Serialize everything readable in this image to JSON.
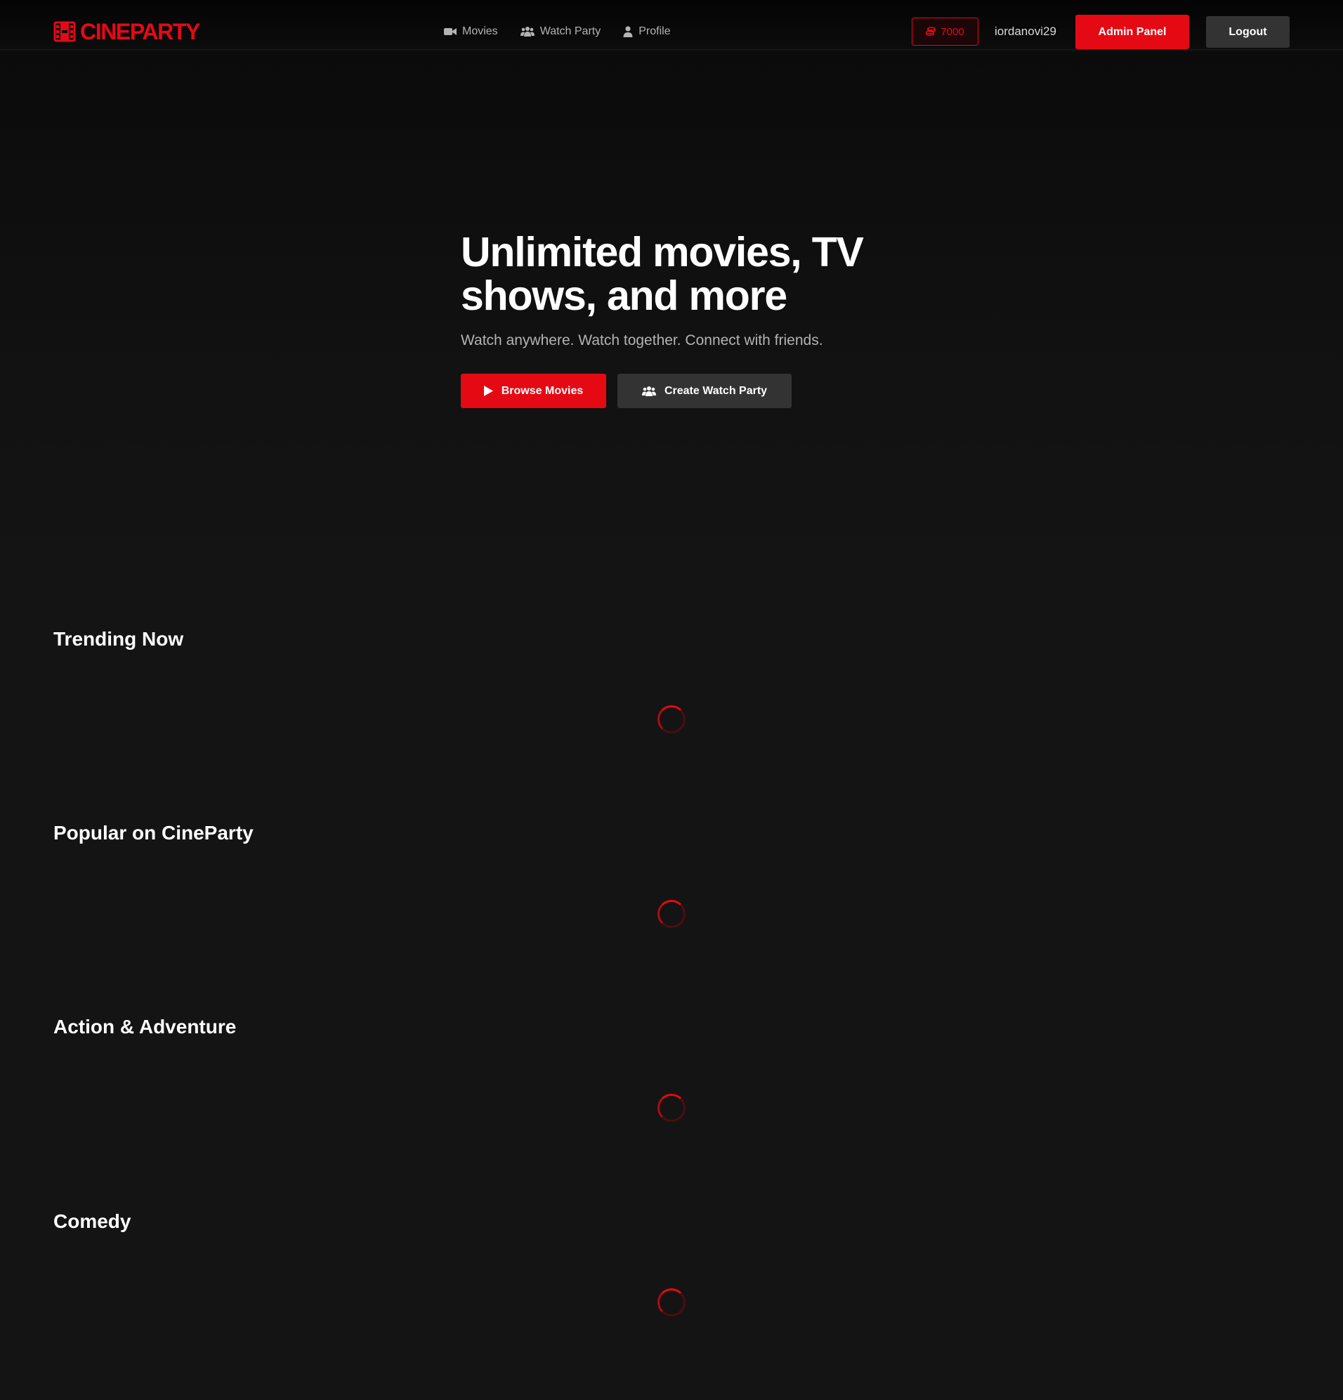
{
  "brand": {
    "name": "CINEPARTY",
    "color": "#e50914"
  },
  "nav": {
    "items": [
      {
        "label": "Movies",
        "icon": "video-camera-icon"
      },
      {
        "label": "Watch Party",
        "icon": "users-icon"
      },
      {
        "label": "Profile",
        "icon": "user-icon"
      }
    ]
  },
  "account": {
    "coins": "7000",
    "coins_icon": "coins-icon",
    "username": "iordanovi29",
    "admin_label": "Admin Panel",
    "logout_label": "Logout"
  },
  "hero": {
    "title": "Unlimited movies, TV shows, and more",
    "subtitle": "Watch anywhere. Watch together. Connect with friends.",
    "browse_label": "Browse Movies",
    "party_label": "Create Watch Party"
  },
  "sections": [
    {
      "title": "Trending Now",
      "state": "loading"
    },
    {
      "title": "Popular on CineParty",
      "state": "loading"
    },
    {
      "title": "Action & Adventure",
      "state": "loading"
    },
    {
      "title": "Comedy",
      "state": "loading"
    }
  ],
  "colors": {
    "accent": "#e50914",
    "background": "#141414",
    "secondary_button": "#333333",
    "muted_text": "#b3b3b3"
  }
}
